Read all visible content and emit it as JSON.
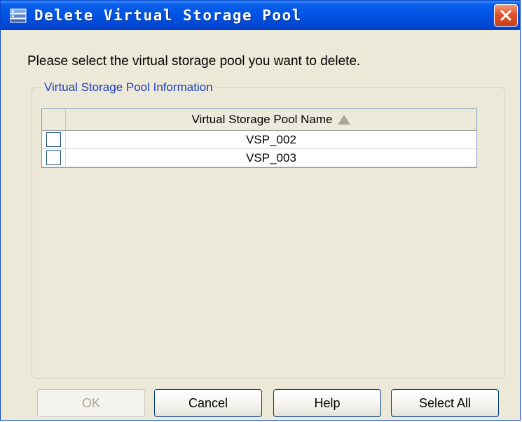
{
  "window": {
    "title": "Delete Virtual Storage Pool",
    "close_label": "✕"
  },
  "instruction": "Please select the virtual storage pool you want to delete.",
  "group": {
    "label": "Virtual Storage Pool Information"
  },
  "table": {
    "columns": [
      "",
      "Virtual Storage Pool Name"
    ],
    "sort": "ascending",
    "rows": [
      {
        "checked": false,
        "name": "VSP_002"
      },
      {
        "checked": false,
        "name": "VSP_003"
      }
    ]
  },
  "buttons": {
    "ok": "OK",
    "cancel": "Cancel",
    "help": "Help",
    "select_all": "Select All"
  },
  "colors": {
    "titlebar": "#0055e5",
    "group_label": "#1c3fbf",
    "close": "#e2532a",
    "dialog_bg": "#ece9d8"
  }
}
